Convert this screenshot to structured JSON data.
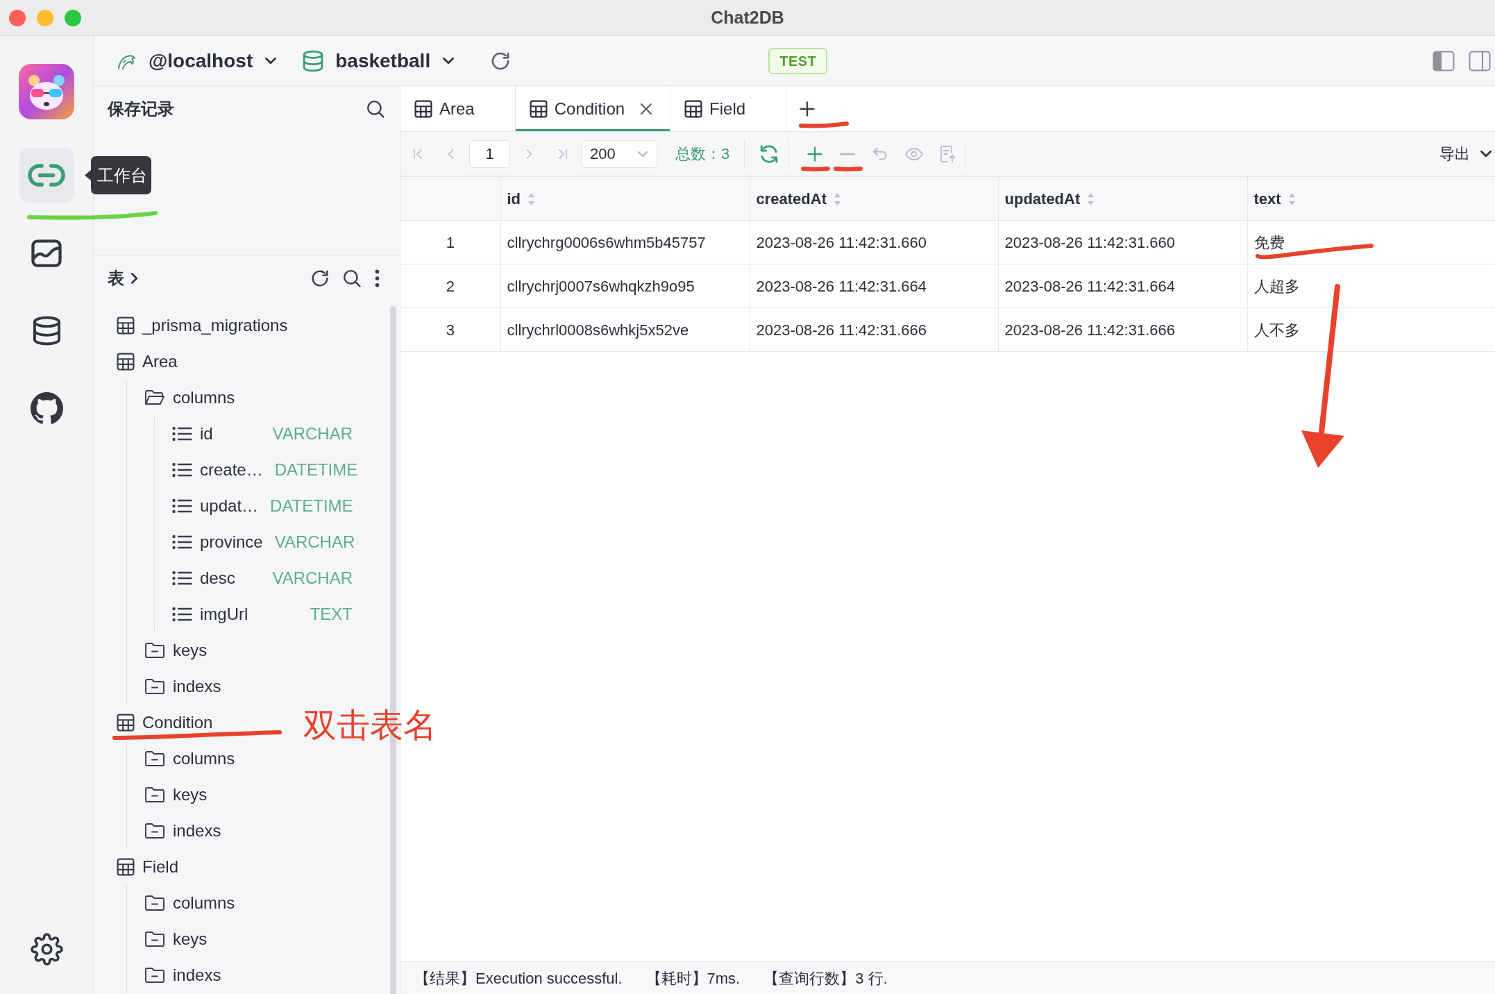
{
  "window": {
    "title": "Chat2DB"
  },
  "activity_bar": {
    "items": [
      {
        "kind": "workspace",
        "selected": true,
        "tooltip": "工作台",
        "annotation": {
          "kind": "underline",
          "color": "#6bd443"
        }
      },
      {
        "kind": "dashboard",
        "selected": false
      },
      {
        "kind": "database",
        "selected": false
      },
      {
        "kind": "github",
        "selected": false
      }
    ]
  },
  "connection_bar": {
    "host": "@localhost",
    "database": "basketball",
    "environment": "TEST"
  },
  "saved_panel": {
    "title": "保存记录"
  },
  "tables_panel": {
    "title": "表",
    "tree": [
      {
        "kind": "table",
        "label": "_prisma_migrations"
      },
      {
        "kind": "table",
        "label": "Area",
        "children": [
          {
            "kind": "folder",
            "label": "columns",
            "expanded": true,
            "children": [
              {
                "kind": "column",
                "label": "id",
                "type": "VARCHAR"
              },
              {
                "kind": "column",
                "label": "create…",
                "type": "DATETIME"
              },
              {
                "kind": "column",
                "label": "updat…",
                "type": "DATETIME"
              },
              {
                "kind": "column",
                "label": "province",
                "type": "VARCHAR"
              },
              {
                "kind": "column",
                "label": "desc",
                "type": "VARCHAR"
              },
              {
                "kind": "column",
                "label": "imgUrl",
                "type": "TEXT"
              }
            ]
          },
          {
            "kind": "folder",
            "label": "keys",
            "expanded": false
          },
          {
            "kind": "folder",
            "label": "indexs",
            "expanded": false
          }
        ]
      },
      {
        "kind": "table",
        "label": "Condition",
        "annotation": {
          "kind": "underline",
          "color": "#e8412c",
          "note": "双击表名"
        },
        "children": [
          {
            "kind": "folder",
            "label": "columns",
            "expanded": false
          },
          {
            "kind": "folder",
            "label": "keys",
            "expanded": false
          },
          {
            "kind": "folder",
            "label": "indexs",
            "expanded": false
          }
        ]
      },
      {
        "kind": "table",
        "label": "Field",
        "children": [
          {
            "kind": "folder",
            "label": "columns",
            "expanded": false
          },
          {
            "kind": "folder",
            "label": "keys",
            "expanded": false
          },
          {
            "kind": "folder",
            "label": "indexs",
            "expanded": false
          }
        ]
      }
    ]
  },
  "tabs": {
    "items": [
      {
        "label": "Area",
        "selected": false
      },
      {
        "label": "Condition",
        "selected": true
      },
      {
        "label": "Field",
        "selected": false
      }
    ],
    "new_tab": {
      "annotation": {
        "kind": "underline",
        "color": "#e8412c"
      }
    }
  },
  "toolbar": {
    "navigation": [
      {
        "kind": "first",
        "disabled": true
      },
      {
        "kind": "previous",
        "disabled": true
      },
      {
        "kind": "next",
        "disabled": true
      },
      {
        "kind": "last",
        "disabled": true
      }
    ],
    "page": "1",
    "page_size": "200",
    "total": "总数：3",
    "actions": [
      {
        "kind": "refresh",
        "disabled": false
      },
      {
        "kind": "add_row",
        "disabled": false,
        "annotation": {
          "kind": "underline",
          "color": "#e8412c"
        }
      },
      {
        "kind": "delete_row",
        "disabled": true,
        "annotation": {
          "kind": "underline",
          "color": "#e8412c"
        }
      },
      {
        "kind": "undo",
        "disabled": true
      },
      {
        "kind": "preview",
        "disabled": true
      },
      {
        "kind": "submit",
        "disabled": true
      }
    ],
    "export": "导出"
  },
  "table": {
    "columns": [
      "id",
      "createdAt",
      "updatedAt",
      "text"
    ],
    "rows": [
      {
        "number": "1",
        "cells": [
          {
            "text": "cllrychrg0006s6whm5b45757"
          },
          {
            "text": "2023-08-26 11:42:31.660"
          },
          {
            "text": "2023-08-26 11:42:31.660"
          },
          {
            "text": "免费",
            "annotation": {
              "kind": "underline",
              "color": "#e8412c"
            }
          }
        ]
      },
      {
        "number": "2",
        "cells": [
          {
            "text": "cllrychrj0007s6whqkzh9o95"
          },
          {
            "text": "2023-08-26 11:42:31.664"
          },
          {
            "text": "2023-08-26 11:42:31.664"
          },
          {
            "text": "人超多"
          }
        ]
      },
      {
        "number": "3",
        "cells": [
          {
            "text": "cllrychrl0008s6whkj5x52ve"
          },
          {
            "text": "2023-08-26 11:42:31.666"
          },
          {
            "text": "2023-08-26 11:42:31.666"
          },
          {
            "text": "人不多"
          }
        ]
      }
    ],
    "annotation": {
      "kind": "arrow",
      "color": "#e8412c"
    }
  },
  "status_bar": {
    "items": [
      "【结果】Execution successful.",
      "【耗时】7ms.",
      "【查询行数】3 行."
    ]
  }
}
